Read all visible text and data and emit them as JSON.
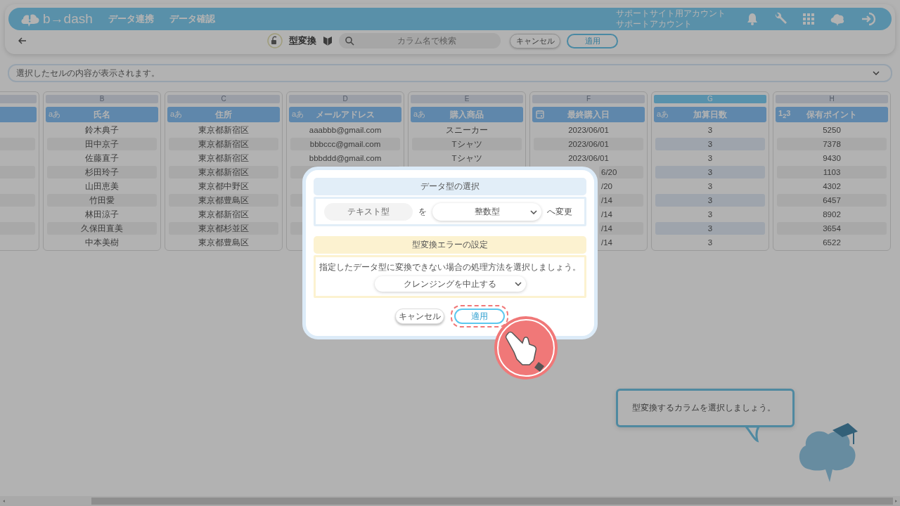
{
  "header": {
    "logo": "b→dash",
    "nav": [
      {
        "label": "データ連携"
      },
      {
        "label": "データ確認"
      }
    ],
    "account": [
      "サポートサイト用アカウント",
      "サポートアカウント"
    ]
  },
  "toolbar": {
    "title": "型変換",
    "search": {
      "placeholder": "カラム名で検索"
    },
    "cancel": "キャンセル",
    "apply": "適用"
  },
  "cell_viewer": {
    "placeholder": "選択したセルの内容が表示されます。"
  },
  "columns": [
    {
      "letter": "B",
      "type": {
        "kind": "text",
        "label": "aあ"
      },
      "name": "氏名",
      "selected": false,
      "cells": [
        {
          "text": "鈴木典子"
        },
        {
          "text": "田中京子"
        },
        {
          "text": "佐藤直子"
        },
        {
          "text": "杉田玲子"
        },
        {
          "text": "山田恵美"
        },
        {
          "text": "竹田愛"
        },
        {
          "text": "林田涼子"
        },
        {
          "text": "久保田直美"
        },
        {
          "text": "中本美樹"
        }
      ]
    },
    {
      "letter": "C",
      "type": {
        "kind": "text",
        "label": "aあ"
      },
      "name": "住所",
      "selected": false,
      "cells": [
        {
          "text": "東京都新宿区"
        },
        {
          "text": "東京都新宿区"
        },
        {
          "text": "東京都新宿区"
        },
        {
          "text": "東京都新宿区"
        },
        {
          "text": "東京都中野区"
        },
        {
          "text": "東京都豊島区"
        },
        {
          "text": "東京都新宿区"
        },
        {
          "text": "東京都杉並区"
        },
        {
          "text": "東京都豊島区"
        }
      ]
    },
    {
      "letter": "D",
      "type": {
        "kind": "text",
        "label": "aあ"
      },
      "name": "メールアドレス",
      "selected": false,
      "cells": [
        {
          "text": "aaabbb@gmail.com"
        },
        {
          "text": "bbbccc@gmail.com"
        },
        {
          "text": "bbbddd@gmail.com"
        }
      ]
    },
    {
      "letter": "E",
      "type": {
        "kind": "text",
        "label": "aあ"
      },
      "name": "購入商品",
      "selected": false,
      "cells": [
        {
          "text": "スニーカー"
        },
        {
          "text": "Tシャツ"
        },
        {
          "text": "Tシャツ"
        }
      ]
    },
    {
      "letter": "F",
      "type": {
        "kind": "date"
      },
      "name": "最終購入日",
      "selected": false,
      "cells": [
        {
          "text": "2023/06/01"
        },
        {
          "text": "2023/06/01"
        },
        {
          "text": "2023/06/01"
        },
        {
          "text": "6/20",
          "covered": true
        },
        {
          "text": "/20",
          "covered": true
        },
        {
          "text": "/14",
          "covered": true
        },
        {
          "text": "/14",
          "covered": true
        },
        {
          "text": "/14",
          "covered": true
        },
        {
          "text": "/14",
          "covered": true
        }
      ]
    },
    {
      "letter": "G",
      "type": {
        "kind": "text",
        "label": "aあ"
      },
      "name": "加算日数",
      "selected": true,
      "cells": [
        {
          "text": "3"
        },
        {
          "text": "3"
        },
        {
          "text": "3"
        },
        {
          "text": "3"
        },
        {
          "text": "3"
        },
        {
          "text": "3"
        },
        {
          "text": "3"
        },
        {
          "text": "3"
        },
        {
          "text": "3"
        }
      ]
    },
    {
      "letter": "H",
      "type": {
        "kind": "number",
        "label": "1$_{2}$3"
      },
      "name": "保有ポイント",
      "selected": false,
      "cells": [
        {
          "text": "5250"
        },
        {
          "text": "7378"
        },
        {
          "text": "9430"
        },
        {
          "text": "1103"
        },
        {
          "text": "4302"
        },
        {
          "text": "6457"
        },
        {
          "text": "8902"
        },
        {
          "text": "3654"
        },
        {
          "text": "6522"
        }
      ]
    }
  ],
  "dialog": {
    "type_section": {
      "title": "データ型の選択",
      "from": "テキスト型",
      "particle": "を",
      "to": "整数型",
      "suffix": "へ変更"
    },
    "error_section": {
      "title": "型変換エラーの設定",
      "message": "指定したデータ型に変換できない場合の処理方法を選択しましょう。",
      "option": "クレンジングを中止する"
    },
    "buttons": [
      {
        "label": "キャンセル",
        "kind": "cancel",
        "highlighted": false
      },
      {
        "label": "適用",
        "kind": "apply",
        "highlighted": true
      }
    ]
  },
  "hint": {
    "text": "型変換するカラムを選択しましょう。"
  }
}
